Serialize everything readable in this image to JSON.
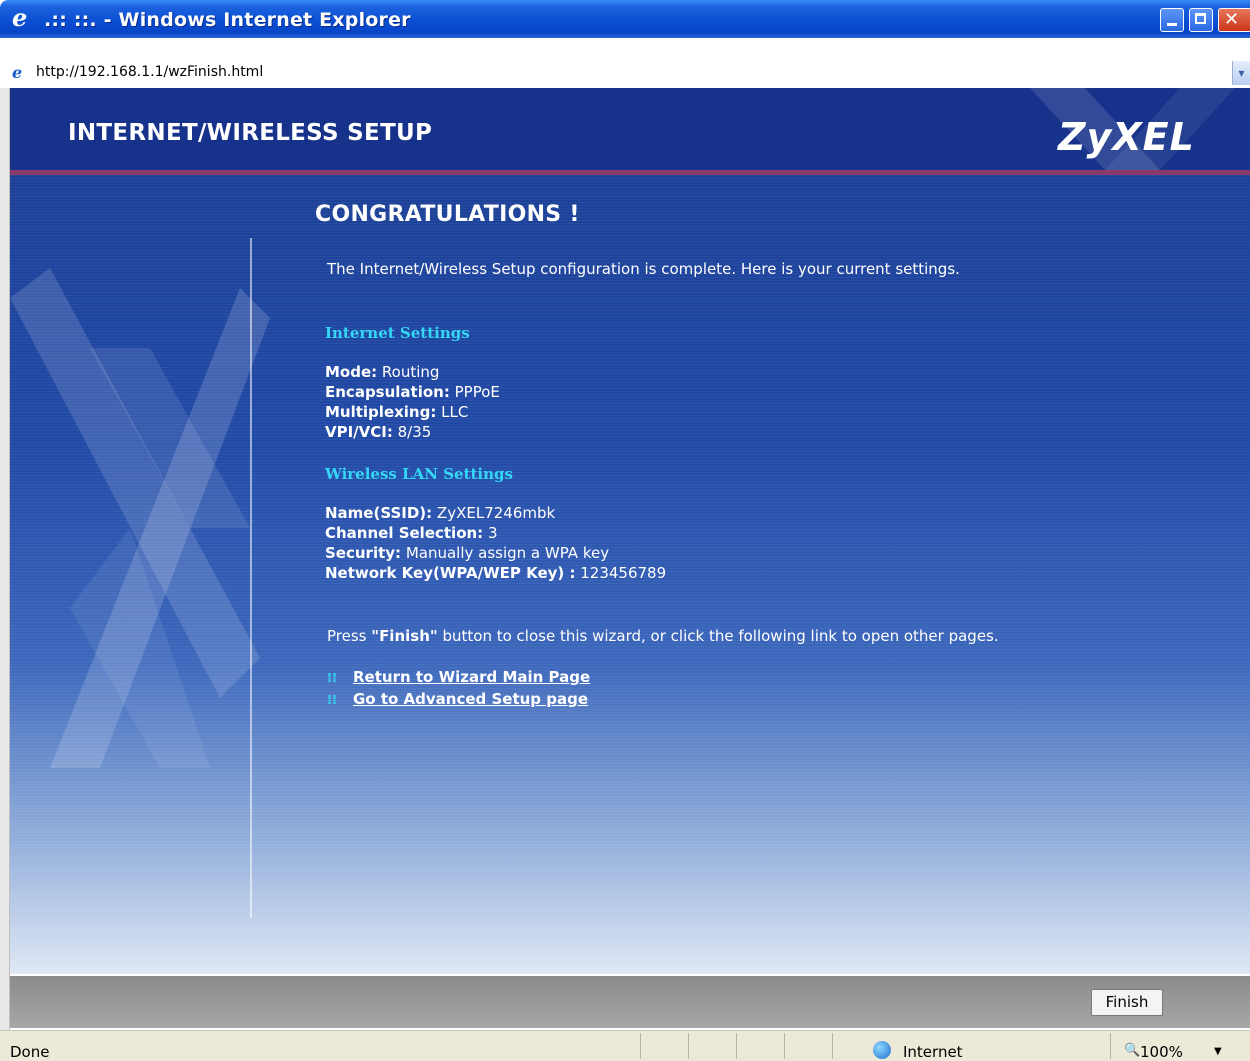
{
  "window": {
    "title": ".:: ::. - Windows Internet Explorer",
    "url": "http://192.168.1.1/wzFinish.html"
  },
  "header": {
    "title": "INTERNET/WIRELESS SETUP",
    "brand": "ZyXEL"
  },
  "main": {
    "heading": "CONGRATULATIONS !",
    "intro": "The Internet/Wireless Setup configuration is complete. Here is your current settings.",
    "internet": {
      "title": "Internet Settings",
      "rows": [
        {
          "label": "Mode:",
          "value": " Routing"
        },
        {
          "label": "Encapsulation:",
          "value": " PPPoE"
        },
        {
          "label": "Multiplexing:",
          "value": " LLC"
        },
        {
          "label": "VPI/VCI:",
          "value": " 8/35"
        }
      ]
    },
    "wireless": {
      "title": "Wireless LAN Settings",
      "rows": [
        {
          "label": "Name(SSID):",
          "value": " ZyXEL7246mbk"
        },
        {
          "label": "Channel Selection:",
          "value": " 3"
        },
        {
          "label": "Security:",
          "value": " Manually assign a WPA key"
        },
        {
          "label": "Network Key(WPA/WEP Key) :",
          "value": " 123456789"
        }
      ]
    },
    "press_before": "Press ",
    "press_bold": "\"Finish\"",
    "press_after": " button to close this wizard, or click the following link to open other pages.",
    "links": [
      {
        "label": "Return to Wizard Main Page"
      },
      {
        "label": "Go to Advanced Setup page"
      }
    ]
  },
  "footer": {
    "finish_label": "Finish"
  },
  "status": {
    "text": "Done",
    "zone": "Internet",
    "zoom": "100%"
  },
  "colors": {
    "section_title": "#34d7f5",
    "header_bg": "#16328a",
    "accent_stripe": "#8a3a6a"
  }
}
